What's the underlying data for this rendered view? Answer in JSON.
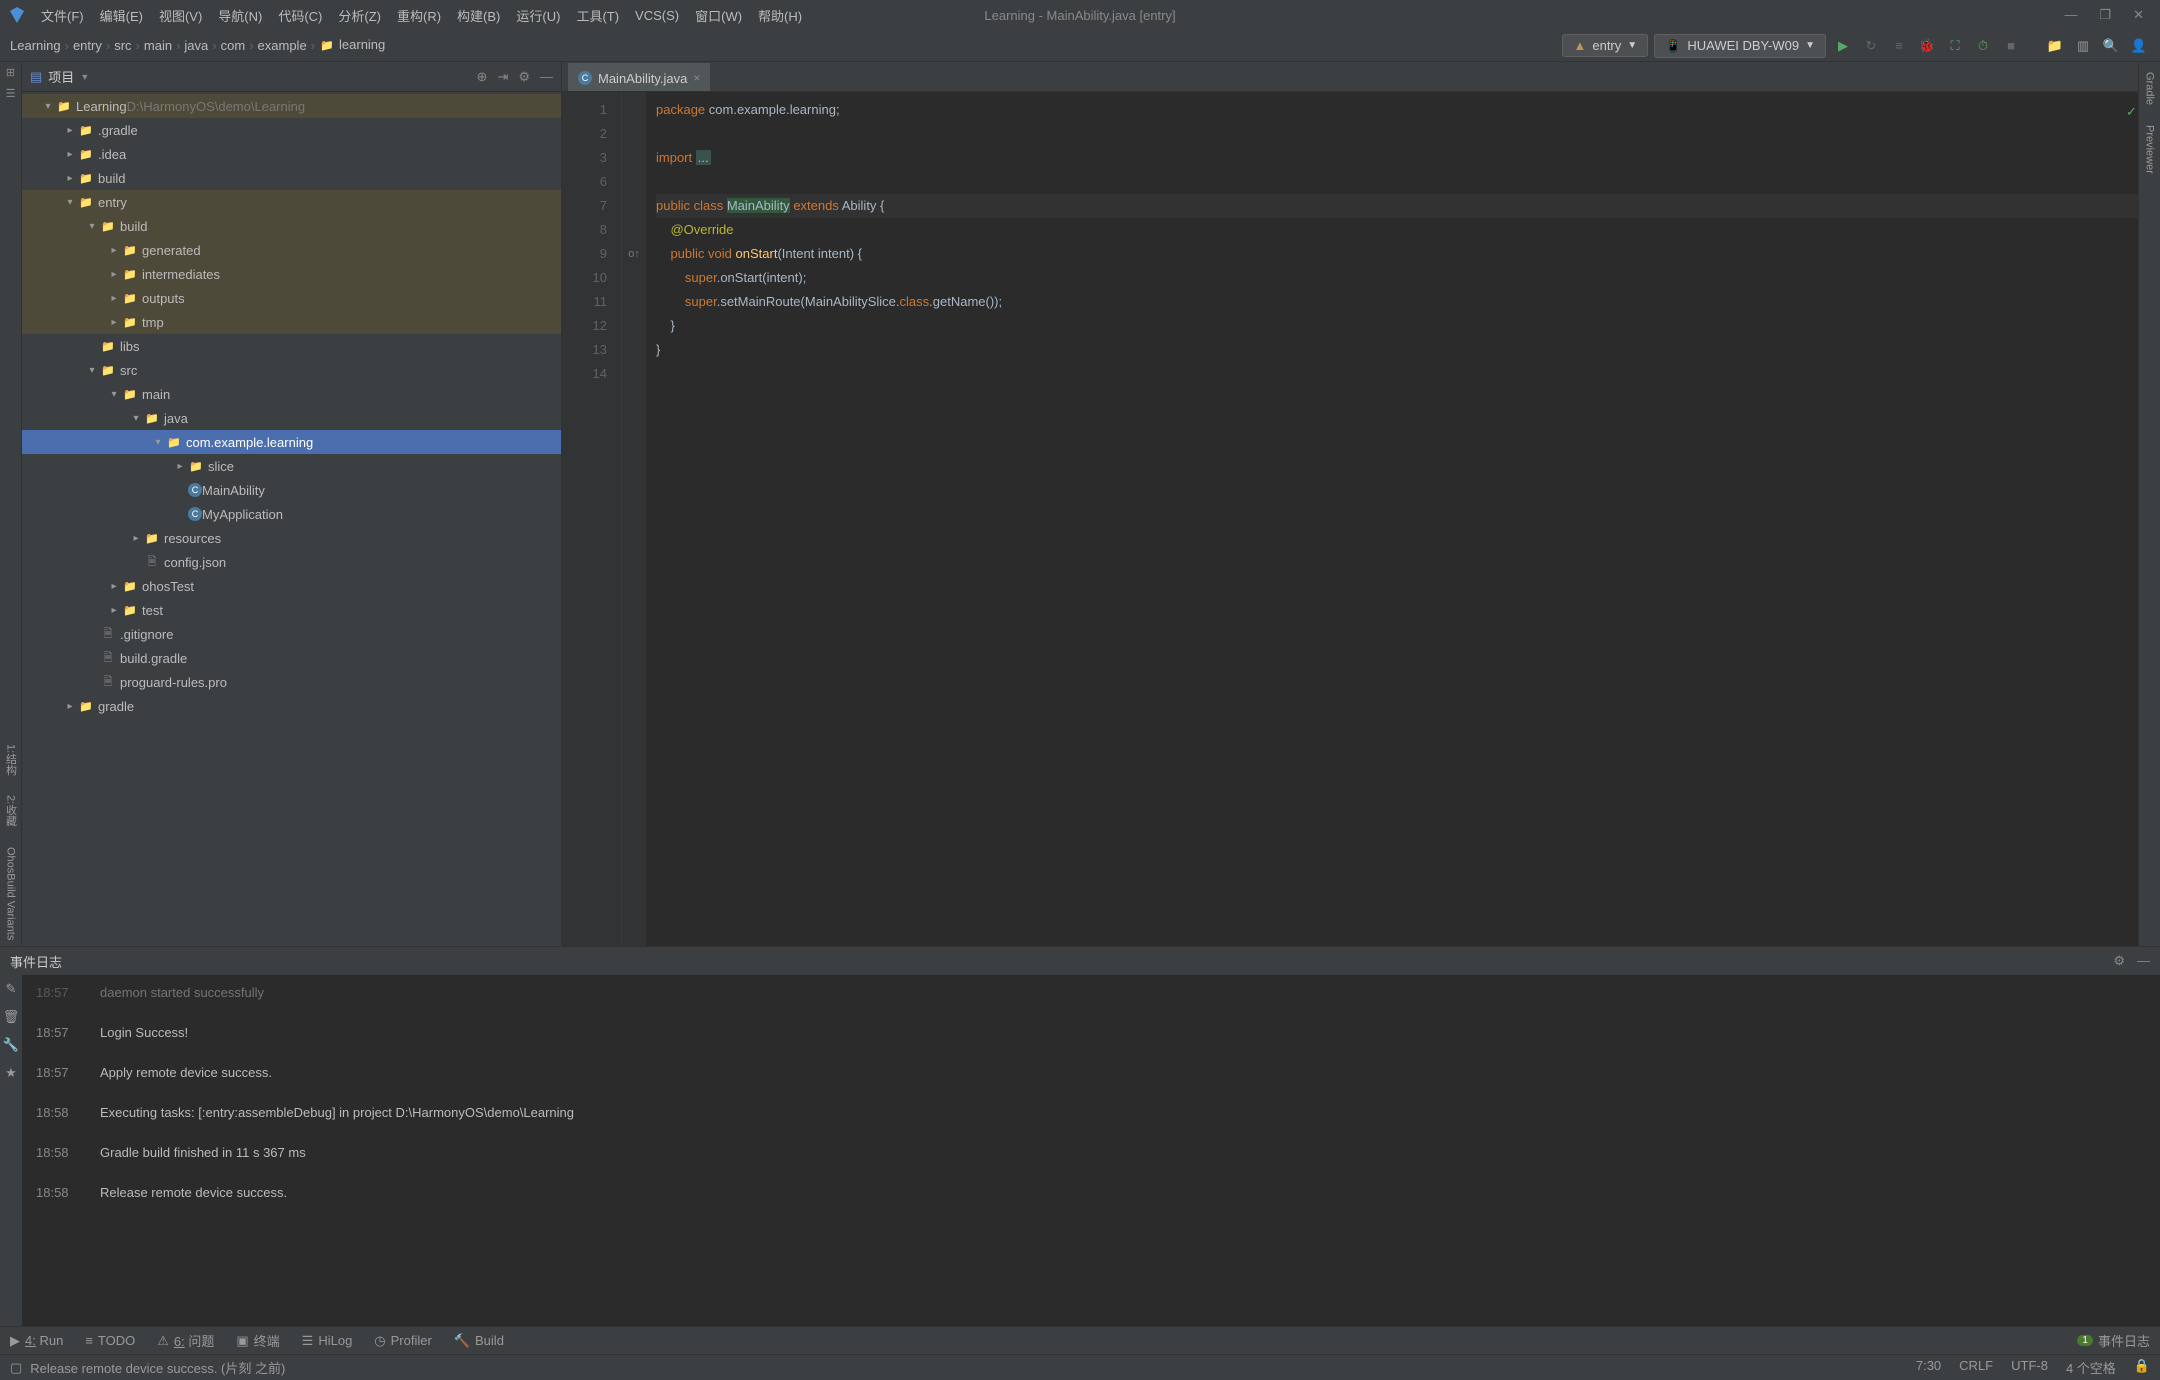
{
  "window_title": "Learning - MainAbility.java [entry]",
  "menu": [
    "文件(F)",
    "编辑(E)",
    "视图(V)",
    "导航(N)",
    "代码(C)",
    "分析(Z)",
    "重构(R)",
    "构建(B)",
    "运行(U)",
    "工具(T)",
    "VCS(S)",
    "窗口(W)",
    "帮助(H)"
  ],
  "breadcrumb": [
    "Learning",
    "entry",
    "src",
    "main",
    "java",
    "com",
    "example",
    "learning"
  ],
  "breadcrumb_final_icon": true,
  "run_config": "entry",
  "device": "HUAWEI DBY-W09",
  "project_panel_title": "项目",
  "project_root_path": "D:\\HarmonyOS\\demo\\Learning",
  "tree": [
    {
      "d": 0,
      "exp": true,
      "icon": "folder",
      "label": "Learning",
      "extra": "D:\\HarmonyOS\\demo\\Learning",
      "hl": true
    },
    {
      "d": 1,
      "exp": false,
      "icon": "folder",
      "label": ".gradle"
    },
    {
      "d": 1,
      "exp": false,
      "icon": "folder",
      "label": ".idea"
    },
    {
      "d": 1,
      "exp": false,
      "icon": "folder",
      "label": "build"
    },
    {
      "d": 1,
      "exp": true,
      "icon": "folder",
      "label": "entry",
      "hl": true
    },
    {
      "d": 2,
      "exp": true,
      "icon": "folder",
      "label": "build",
      "hl": true
    },
    {
      "d": 3,
      "exp": false,
      "icon": "folder",
      "label": "generated",
      "hl": true
    },
    {
      "d": 3,
      "exp": false,
      "icon": "folder",
      "label": "intermediates",
      "hl": true
    },
    {
      "d": 3,
      "exp": false,
      "icon": "folder",
      "label": "outputs",
      "hl": true
    },
    {
      "d": 3,
      "exp": false,
      "icon": "folder",
      "label": "tmp",
      "hl": true
    },
    {
      "d": 2,
      "leaf": true,
      "icon": "folder-g",
      "label": "libs"
    },
    {
      "d": 2,
      "exp": true,
      "icon": "folder-g",
      "label": "src"
    },
    {
      "d": 3,
      "exp": true,
      "icon": "folder-g",
      "label": "main"
    },
    {
      "d": 4,
      "exp": true,
      "icon": "folder-g",
      "label": "java"
    },
    {
      "d": 5,
      "exp": true,
      "icon": "folder-g",
      "label": "com.example.learning",
      "sel": true
    },
    {
      "d": 6,
      "exp": false,
      "icon": "folder-g",
      "label": "slice"
    },
    {
      "d": 6,
      "leaf": true,
      "icon": "class",
      "label": "MainAbility"
    },
    {
      "d": 6,
      "leaf": true,
      "icon": "class",
      "label": "MyApplication"
    },
    {
      "d": 4,
      "exp": false,
      "icon": "folder-g",
      "label": "resources"
    },
    {
      "d": 4,
      "leaf": true,
      "icon": "file",
      "label": "config.json"
    },
    {
      "d": 3,
      "exp": false,
      "icon": "folder-g",
      "label": "ohosTest"
    },
    {
      "d": 3,
      "exp": false,
      "icon": "folder-g",
      "label": "test"
    },
    {
      "d": 2,
      "leaf": true,
      "icon": "file",
      "label": ".gitignore"
    },
    {
      "d": 2,
      "leaf": true,
      "icon": "file",
      "label": "build.gradle"
    },
    {
      "d": 2,
      "leaf": true,
      "icon": "file",
      "label": "proguard-rules.pro"
    },
    {
      "d": 1,
      "exp": false,
      "icon": "folder-g",
      "label": "gradle"
    }
  ],
  "editor_tab": "MainAbility.java",
  "code_lines": [
    {
      "n": 1,
      "html": "<span class='kw'>package</span> com.example.learning;"
    },
    {
      "n": 2,
      "html": ""
    },
    {
      "n": 3,
      "html": "<span class='kw'>import</span> <span class='fold'>...</span>"
    },
    {
      "n": 6,
      "html": ""
    },
    {
      "n": 7,
      "html": "<span class='kw'>public class</span> <span class='ident-hl'>MainAbility</span> <span class='kw'>extends</span> Ability {",
      "cur": true
    },
    {
      "n": 8,
      "html": "    <span class='anno'>@Override</span>"
    },
    {
      "n": 9,
      "html": "    <span class='kw'>public void</span> <span class='fn'>onStart</span>(Intent intent) {",
      "mark": "o↑"
    },
    {
      "n": 10,
      "html": "        <span class='kw'>super</span>.onStart(intent);"
    },
    {
      "n": 11,
      "html": "        <span class='kw'>super</span>.setMainRoute(MainAbilitySlice.<span class='kw'>class</span>.getName());"
    },
    {
      "n": 12,
      "html": "    }"
    },
    {
      "n": 13,
      "html": "}"
    },
    {
      "n": 14,
      "html": ""
    }
  ],
  "event_log_title": "事件日志",
  "event_log": [
    {
      "t": "18:57",
      "m": "daemon started successfully",
      "faded": true
    },
    {
      "t": "18:57",
      "m": "Login Success!"
    },
    {
      "t": "18:57",
      "m": "Apply remote device success."
    },
    {
      "t": "18:58",
      "m": "Executing tasks: [:entry:assembleDebug] in project D:\\HarmonyOS\\demo\\Learning"
    },
    {
      "t": "18:58",
      "m": "Gradle build finished in 11 s 367 ms"
    },
    {
      "t": "18:58",
      "m": "Release remote device success."
    }
  ],
  "bottom_tools": [
    {
      "icon": "▶",
      "label": "4: Run",
      "u": true
    },
    {
      "icon": "≡",
      "label": "TODO"
    },
    {
      "icon": "⚠",
      "label": "6: 问题",
      "u": true
    },
    {
      "icon": "▣",
      "label": "终端"
    },
    {
      "icon": "☰",
      "label": "HiLog"
    },
    {
      "icon": "◷",
      "label": "Profiler"
    },
    {
      "icon": "🔨",
      "label": "Build"
    }
  ],
  "bottom_right_tool": {
    "badge": "1",
    "label": "事件日志"
  },
  "status_message": "Release remote device success. (片刻 之前)",
  "status_right": [
    "7:30",
    "CRLF",
    "UTF-8",
    "4 个空格",
    "🔒"
  ],
  "left_tabs": [
    "1:结构",
    "2:收藏",
    "OhosBuild Variants"
  ],
  "right_tabs": [
    "Gradle",
    "Previewer"
  ]
}
